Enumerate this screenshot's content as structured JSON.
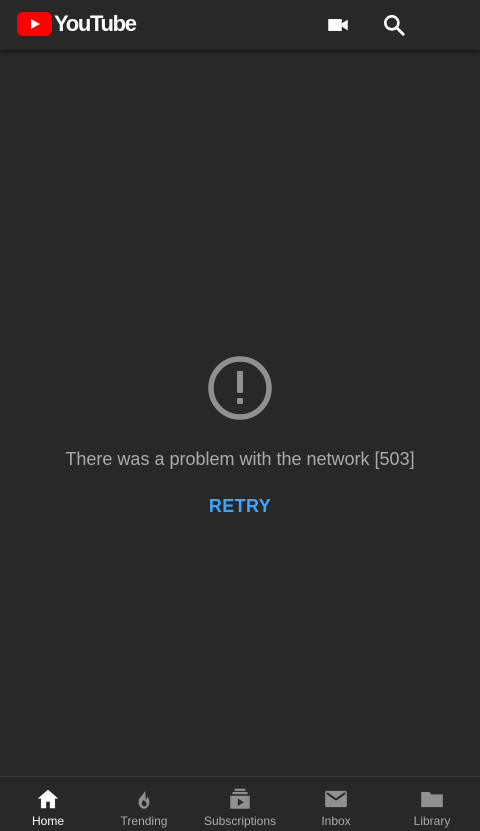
{
  "header": {
    "logo_text": "YouTube",
    "logo_icon": "youtube-logo",
    "actions": [
      {
        "icon": "video-camera-icon"
      },
      {
        "icon": "search-icon"
      }
    ]
  },
  "error": {
    "icon": "alert-circle-icon",
    "message": "There was a problem with the network [503]",
    "retry_label": "RETRY"
  },
  "bottom_nav": {
    "items": [
      {
        "label": "Home",
        "icon": "home-icon",
        "active": true
      },
      {
        "label": "Trending",
        "icon": "flame-icon",
        "active": false
      },
      {
        "label": "Subscriptions",
        "icon": "subscriptions-icon",
        "active": false
      },
      {
        "label": "Inbox",
        "icon": "envelope-icon",
        "active": false
      },
      {
        "label": "Library",
        "icon": "folder-icon",
        "active": false
      }
    ]
  },
  "colors": {
    "background": "#282828",
    "brand_red": "#ff0000",
    "link_blue": "#3ea6ff",
    "muted_text": "#aaaaaa",
    "icon_muted": "#909090",
    "active": "#ffffff"
  }
}
